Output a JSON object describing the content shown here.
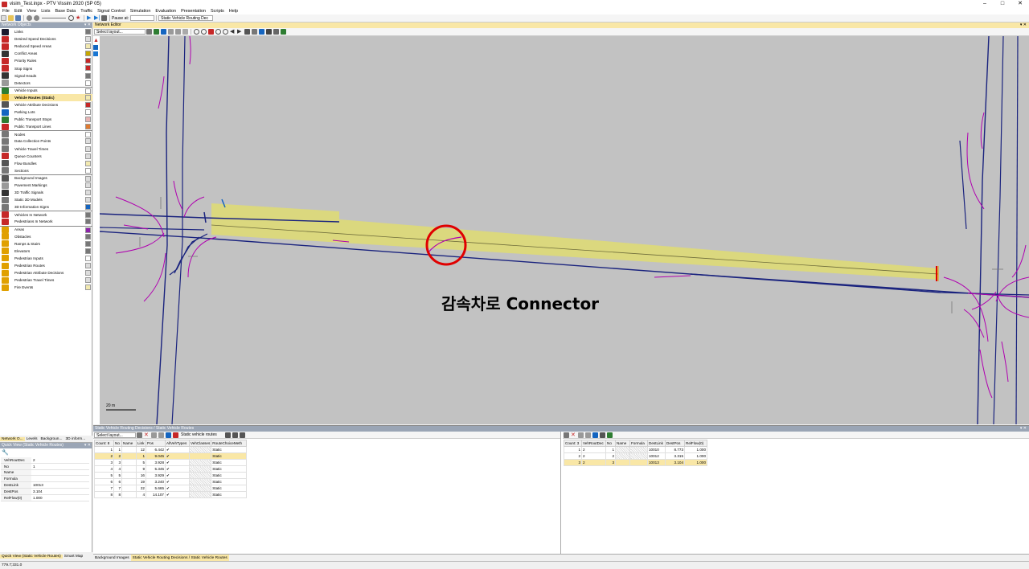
{
  "app": {
    "window_title": "visim_Test.inpx - PTV Vissim 2020 (SP 05)",
    "menu": [
      "File",
      "Edit",
      "View",
      "Lists",
      "Base Data",
      "Traffic",
      "Signal Control",
      "Simulation",
      "Evaluation",
      "Presentation",
      "Scripts",
      "Help"
    ],
    "pause_at_label": "Pause at:",
    "pause_at_value": "",
    "list_dropdown": "Static Vehicle Routing Dec"
  },
  "network_objects": {
    "title": "Network Objects",
    "items": [
      {
        "label": "Links",
        "icon_color": "#1a1a2e",
        "swatch": "#777"
      },
      {
        "label": "Desired Speed Decisions",
        "icon_color": "#c62828",
        "swatch": "#ddd"
      },
      {
        "label": "Reduced Speed Areas",
        "icon_color": "#c62828",
        "swatch": "#f2e9b0"
      },
      {
        "label": "Conflict Areas",
        "icon_color": "#333",
        "swatch": "#c6a700"
      },
      {
        "label": "Priority Rules",
        "icon_color": "#c62828",
        "swatch": "#c62828"
      },
      {
        "label": "Stop Signs",
        "icon_color": "#c62828",
        "swatch": "#c62828"
      },
      {
        "label": "Signal Heads",
        "icon_color": "#333",
        "swatch": "#777"
      },
      {
        "label": "Detectors",
        "icon_color": "#999",
        "swatch": "#ffffff"
      },
      {
        "label": "Vehicle Inputs",
        "icon_color": "#2e7d32",
        "swatch": "#ffffff"
      },
      {
        "label": "Vehicle Routes (Static)",
        "icon_color": "#e0a000",
        "swatch": "#f2e9b0",
        "selected": true
      },
      {
        "label": "Vehicle Attribute Decisions",
        "icon_color": "#555",
        "swatch": "#c62828"
      },
      {
        "label": "Parking Lots",
        "icon_color": "#1565c0",
        "swatch": "#ffffff"
      },
      {
        "label": "Public Transport Stops",
        "icon_color": "#2e7d32",
        "swatch": "#e8b4b4"
      },
      {
        "label": "Public Transport Lines",
        "icon_color": "#c62828",
        "swatch": "#e07a30"
      },
      {
        "label": "Nodes",
        "icon_color": "#777",
        "swatch": "#ffffff"
      },
      {
        "label": "Data Collection Points",
        "icon_color": "#777",
        "swatch": "#ddd"
      },
      {
        "label": "Vehicle Travel Times",
        "icon_color": "#777",
        "swatch": "#ddd"
      },
      {
        "label": "Queue Counters",
        "icon_color": "#c62828",
        "swatch": "#ddd"
      },
      {
        "label": "Flow Bundles",
        "icon_color": "#555",
        "swatch": "#f2e9b0"
      },
      {
        "label": "Sections",
        "icon_color": "#777",
        "swatch": "#ffffff"
      },
      {
        "label": "Background Images",
        "icon_color": "#555",
        "swatch": "#ddd"
      },
      {
        "label": "Pavement Markings",
        "icon_color": "#999",
        "swatch": "#ddd"
      },
      {
        "label": "3D Traffic Signals",
        "icon_color": "#333",
        "swatch": "#ddd"
      },
      {
        "label": "Static 3D Models",
        "icon_color": "#777",
        "swatch": "#ddd"
      },
      {
        "label": "3D Information Signs",
        "icon_color": "#777",
        "swatch": "#1565c0"
      },
      {
        "label": "Vehicles In Network",
        "icon_color": "#c62828",
        "swatch": "#777"
      },
      {
        "label": "Pedestrians In Network",
        "icon_color": "#c62828",
        "swatch": "#777"
      },
      {
        "label": "Areas",
        "icon_color": "#e0a000",
        "swatch": "#8e24aa"
      },
      {
        "label": "Obstacles",
        "icon_color": "#e0a000",
        "swatch": "#777"
      },
      {
        "label": "Ramps & Stairs",
        "icon_color": "#e0a000",
        "swatch": "#777"
      },
      {
        "label": "Elevators",
        "icon_color": "#e0a000",
        "swatch": "#777"
      },
      {
        "label": "Pedestrian Inputs",
        "icon_color": "#e0a000",
        "swatch": "#ffffff"
      },
      {
        "label": "Pedestrian Routes",
        "icon_color": "#e0a000",
        "swatch": "#ddd"
      },
      {
        "label": "Pedestrian Attribute Decisions",
        "icon_color": "#e0a000",
        "swatch": "#ddd"
      },
      {
        "label": "Pedestrian Travel Times",
        "icon_color": "#e0a000",
        "swatch": "#ddd"
      },
      {
        "label": "Fire Events",
        "icon_color": "#e0a000",
        "swatch": "#f2e9b0"
      }
    ]
  },
  "left_tabs": [
    "Network O...",
    "Levels",
    "Backgroun...",
    "3D inform..."
  ],
  "quick_view": {
    "title": "Quick View (Static Vehicle Routes)",
    "rows": [
      {
        "k": "VehRoutDec",
        "v": "2"
      },
      {
        "k": "No",
        "v": "1"
      },
      {
        "k": "Name",
        "v": ""
      },
      {
        "k": "Formula",
        "v": ""
      },
      {
        "k": "DestLink",
        "v": "10013"
      },
      {
        "k": "DestPos",
        "v": "3.104"
      },
      {
        "k": "RelFlow(0)",
        "v": "1.000"
      }
    ],
    "tabs": [
      "Quick View (Static Vehicle Routes)",
      "Smart Map"
    ]
  },
  "editor": {
    "title": "Network Editor",
    "layout_select": "Select layout...",
    "scale_label": "20 m",
    "annotation": "감속차로 Connector"
  },
  "bottom": {
    "title": "Static Vehicle Routing Decisions / Static Vehicle Routes",
    "left_toolbar_select": "Select layout...",
    "left_toolbar_relation": "Static vehicle routes",
    "left_columns": [
      "Count: 8",
      "No",
      "Name",
      "Link",
      "Pos",
      "AllVehTypes",
      "VehClasses",
      "RouteChoiceMeth"
    ],
    "left_rows": [
      [
        "1",
        "1",
        "",
        "12",
        "6.442",
        "✔",
        "",
        "Static"
      ],
      [
        "2",
        "2",
        "",
        "1",
        "9.045",
        "✔",
        "",
        "Static"
      ],
      [
        "3",
        "3",
        "",
        "5",
        "3.928",
        "✔",
        "",
        "Static"
      ],
      [
        "4",
        "4",
        "",
        "9",
        "5.345",
        "✔",
        "",
        "Static"
      ],
      [
        "5",
        "5",
        "",
        "16",
        "3.929",
        "✔",
        "",
        "Static"
      ],
      [
        "6",
        "6",
        "",
        "19",
        "3.240",
        "✔",
        "",
        "Static"
      ],
      [
        "7",
        "7",
        "",
        "22",
        "5.665",
        "✔",
        "",
        "Static"
      ],
      [
        "8",
        "8",
        "",
        "4",
        "14.107",
        "✔",
        "",
        "Static"
      ]
    ],
    "left_selected": 1,
    "right_columns": [
      "Count: 3",
      "VehRoutDec",
      "No",
      "Name",
      "Formula",
      "DestLink",
      "DestPos",
      "RelFlow(0)"
    ],
    "right_rows": [
      [
        "1",
        "2",
        "1",
        "",
        "",
        "10010",
        "8.773",
        "1.000"
      ],
      [
        "2",
        "2",
        "2",
        "",
        "",
        "10012",
        "3.315",
        "1.000"
      ],
      [
        "3",
        "2",
        "3",
        "",
        "",
        "10013",
        "3.104",
        "1.000"
      ]
    ],
    "right_selected": 2,
    "tabs": [
      "Background Images",
      "Static Vehicle Routing Decisions / Static Vehicle Routes"
    ]
  },
  "status": {
    "coords": "779.7;331.0"
  },
  "colors": {
    "accent_selected": "#f9e7a6",
    "link_blue": "#1a237e",
    "connector_magenta": "#b000b0",
    "route_yellow": "#dcd97a",
    "marker_red": "#e00000"
  }
}
